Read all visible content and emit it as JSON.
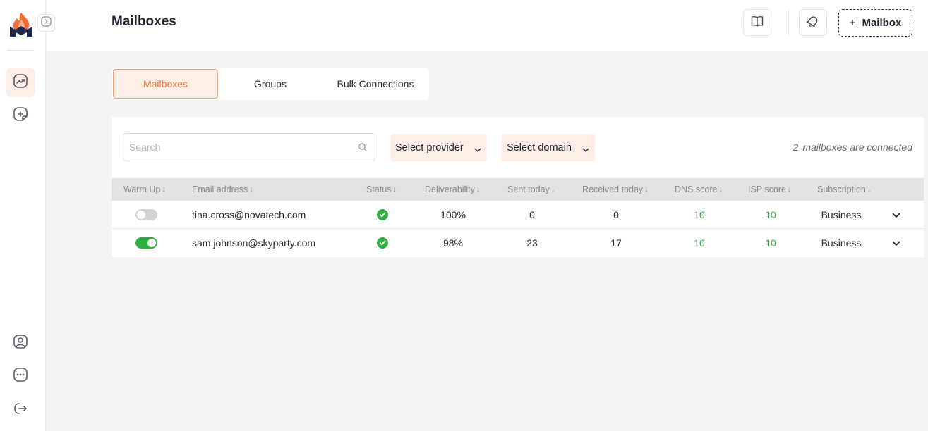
{
  "header": {
    "title": "Mailboxes",
    "add_mailbox_plus": "+",
    "add_mailbox_label": "Mailbox"
  },
  "tabs": [
    {
      "label": "Mailboxes",
      "active": true
    },
    {
      "label": "Groups",
      "active": false
    },
    {
      "label": "Bulk Connections",
      "active": false
    }
  ],
  "filters": {
    "search_placeholder": "Search",
    "provider_label": "Select provider",
    "domain_label": "Select domain",
    "connected_count": "2",
    "connected_text": "mailboxes are connected"
  },
  "table": {
    "columns": [
      "Warm Up",
      "Email address",
      "Status",
      "Deliverability",
      "Sent today",
      "Received today",
      "DNS score",
      "ISP score",
      "Subscription"
    ],
    "sort_arrow": "↓",
    "rows": [
      {
        "warm_up": false,
        "email": "tina.cross@novatech.com",
        "status": "ok",
        "deliverability": "100%",
        "sent_today": "0",
        "received_today": "0",
        "dns_score": "10",
        "isp_score": "10",
        "subscription": "Business"
      },
      {
        "warm_up": true,
        "email": "sam.johnson@skyparty.com",
        "status": "ok",
        "deliverability": "98%",
        "sent_today": "23",
        "received_today": "17",
        "dns_score": "10",
        "isp_score": "10",
        "subscription": "Business"
      }
    ]
  },
  "sidebar": {
    "icons": [
      "flame-logo-icon",
      "expand-sidebar-icon",
      "dashboard-chart-icon",
      "add-document-icon",
      "account-icon",
      "more-options-icon",
      "logout-icon"
    ]
  },
  "colors": {
    "accent": "#e8763f",
    "accent_bg": "#fdeee6",
    "success": "#2fae3f",
    "score": "#3aa84a"
  }
}
